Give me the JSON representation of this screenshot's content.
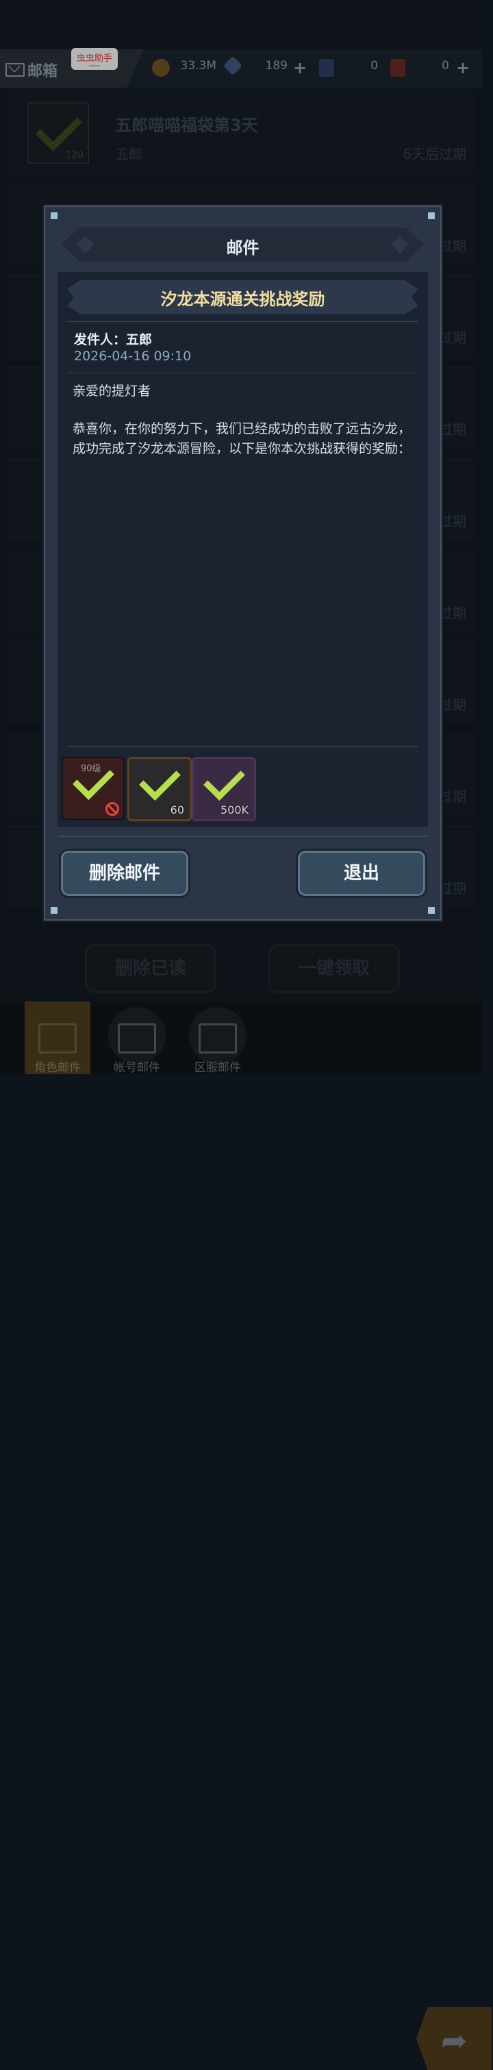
{
  "topbar": {
    "title": "邮箱",
    "helper_badge": "虫虫助手",
    "resources": [
      {
        "icon": "gold-coin-icon",
        "value": "33.3M"
      },
      {
        "icon": "crystal-icon",
        "value": "189"
      },
      {
        "icon": "blue-ticket-icon",
        "value": "0"
      },
      {
        "icon": "red-ticket-icon",
        "value": "0"
      }
    ]
  },
  "mail_list": [
    {
      "title": "五郎喵喵福袋第3天",
      "sender": "五郎",
      "expiry": "6天后过期",
      "count": "120"
    },
    {
      "expiry": "过期"
    },
    {
      "expiry": "过期"
    },
    {
      "expiry": "过期"
    },
    {
      "expiry": "过期"
    },
    {
      "expiry": "过期"
    },
    {
      "expiry": "过期"
    },
    {
      "expiry": "过期"
    },
    {
      "expiry": "过期"
    }
  ],
  "list_actions": {
    "delete_read": "删除已读",
    "claim_all": "一键领取"
  },
  "bottom_nav": [
    {
      "label": "角色邮件"
    },
    {
      "label": "帐号邮件"
    },
    {
      "label": "区服邮件"
    }
  ],
  "dialog": {
    "header": "邮件",
    "subject": "汐龙本源通关挑战奖励",
    "from": "发件人：五郎",
    "date": "2026-04-16 09:10",
    "greeting": "亲爱的提灯者",
    "body": "恭喜你，在你的努力下，我们已经成功的击败了远古汐龙，成功完成了汐龙本源冒险，以下是你本次挑战获得的奖励：",
    "rewards": [
      {
        "icon": "character-card-icon",
        "level": "90级",
        "count": ""
      },
      {
        "icon": "dagger-icon",
        "level": "",
        "count": "60"
      },
      {
        "icon": "coin-bag-icon",
        "level": "",
        "count": "500K"
      }
    ],
    "buttons": {
      "delete": "删除邮件",
      "exit": "退出"
    }
  }
}
